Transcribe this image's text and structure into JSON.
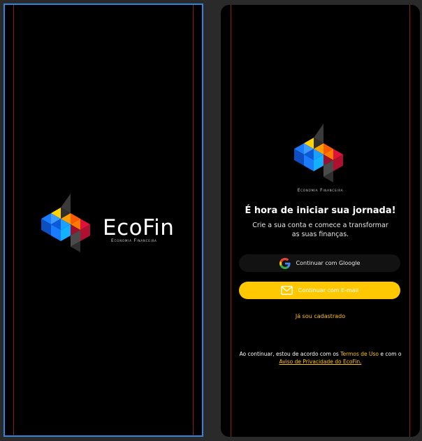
{
  "splash": {
    "brand_name": "EcoFin",
    "brand_subtitle": "Economia Financeira"
  },
  "onboarding": {
    "logo_subtitle": "Economia Financeira",
    "headline": "É hora de iniciar sua jornada!",
    "subline": "Crie a sua conta e comece a transformar as suas finanças.",
    "google_button": "Continuar com Gloogle",
    "email_button": "Continuar com E-mail",
    "already_registered": "Já sou cadastrado",
    "terms_prefix": "Ao continuar, estou de acordo com os",
    "terms_link": "Termos de Uso",
    "terms_middle": "e com o",
    "privacy_link": "Aviso de Privacidade do EcoFin."
  },
  "colors": {
    "accent": "#ffc800",
    "selection_border": "#2d87e0",
    "guide_line": "#8a1c12",
    "logo_yellow": "#ffd400",
    "logo_red": "#e0123c",
    "logo_blue": "#1a7bff",
    "logo_gray": "#3a3a3a"
  },
  "icons": [
    "ecofin-logo-icon",
    "google-icon",
    "mail-icon"
  ]
}
